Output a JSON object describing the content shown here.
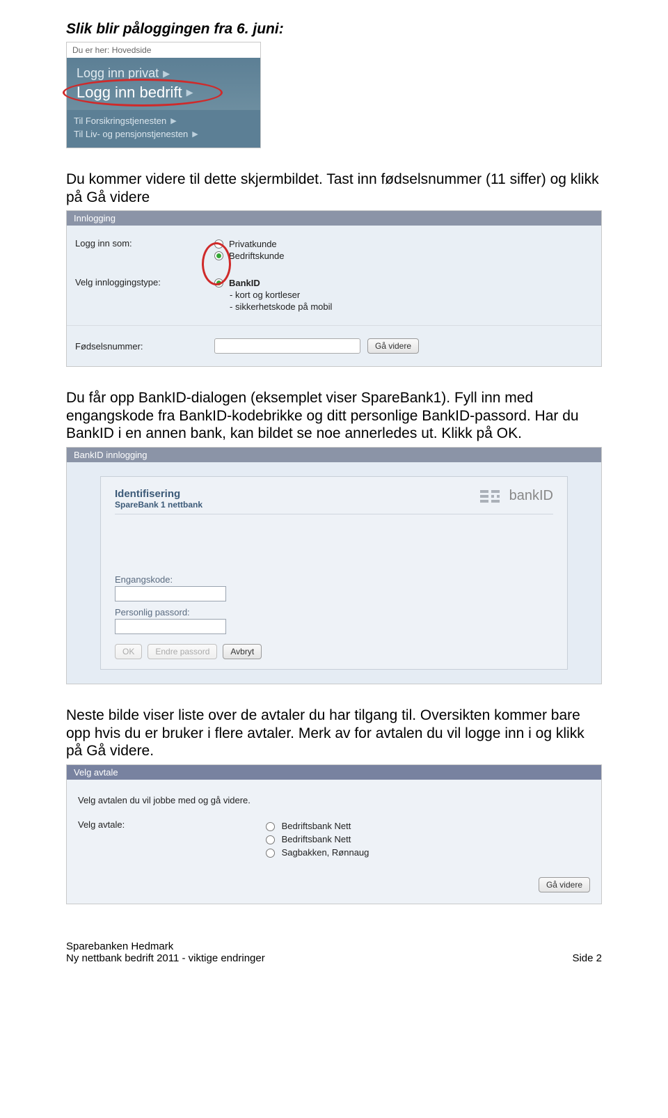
{
  "doc": {
    "heading": "Slik blir påloggingen fra 6. juni:",
    "para1": "Du kommer videre til dette skjermbildet. Tast inn fødselsnummer (11 siffer) og klikk på Gå videre",
    "para2": "Du får opp BankID-dialogen (eksemplet viser SpareBank1). Fyll inn med engangskode fra BankID-kodebrikke og ditt personlige BankID-passord. Har du BankID i en annen bank, kan bildet se noe annerledes ut. Klikk på OK.",
    "para3": "Neste bilde viser liste over de avtaler du har tilgang til. Oversikten kommer bare opp hvis du er bruker i flere avtaler. Merk av for avtalen du vil logge inn i og klikk på Gå videre."
  },
  "loginBox": {
    "breadcrumb": "Du er her: Hovedside",
    "opt1": "Logg inn privat",
    "opt2": "Logg inn bedrift",
    "link1": "Til Forsikringstjenesten",
    "link2": "Til Liv- og pensjonstjenesten"
  },
  "innlog": {
    "title": "Innlogging",
    "lblSom": "Logg inn som:",
    "optPrivat": "Privatkunde",
    "optBedrift": "Bedriftskunde",
    "lblType": "Velg innloggingstype:",
    "optBankID": "BankID",
    "optKort": "- kort og kortleser",
    "optMobil": "- sikkerhetskode på mobil",
    "lblFnr": "Fødselsnummer:",
    "btnGaa": "Gå videre"
  },
  "bankid": {
    "title": "BankID innlogging",
    "headT1": "Identifisering",
    "headT2": "SpareBank 1 nettbank",
    "logoText": "bankID",
    "lblEngang": "Engangskode:",
    "lblPass": "Personlig passord:",
    "btnOK": "OK",
    "btnEndre": "Endre passord",
    "btnAvbryt": "Avbryt"
  },
  "avtale": {
    "title": "Velg avtale",
    "intro": "Velg avtalen du vil jobbe med og gå videre.",
    "lbl": "Velg avtale:",
    "opt1": "Bedriftsbank Nett",
    "opt2": "Bedriftsbank Nett",
    "opt3": "Sagbakken, Rønnaug",
    "btnGaa": "Gå videre"
  },
  "footer": {
    "l1": "Sparebanken Hedmark",
    "l2": "Ny nettbank bedrift 2011 - viktige endringer",
    "page": "Side 2"
  }
}
